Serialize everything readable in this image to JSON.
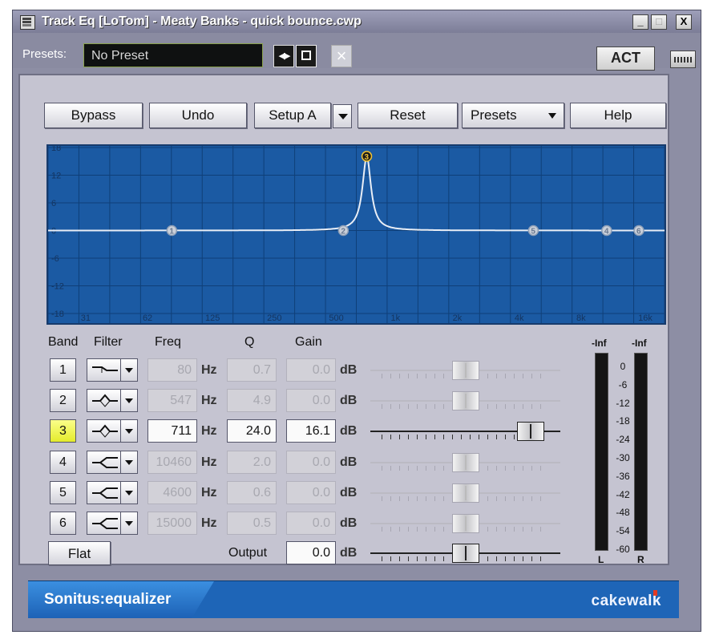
{
  "window": {
    "title": "Track Eq [LoTom] - Meaty Banks - quick bounce.cwp",
    "buttons": {
      "minimize": "_",
      "maximize": "□",
      "close": "X"
    }
  },
  "presets_bar": {
    "label": "Presets:",
    "value": "No Preset",
    "act_label": "ACT"
  },
  "toolbar": {
    "bypass": "Bypass",
    "undo": "Undo",
    "setup": "Setup A",
    "reset": "Reset",
    "presets": "Presets",
    "help": "Help"
  },
  "graph": {
    "y_ticks": [
      "18",
      "12",
      "6",
      "0",
      "-6",
      "-12",
      "-18"
    ],
    "x_ticks": [
      "31",
      "62",
      "125",
      "250",
      "500",
      "1k",
      "2k",
      "4k",
      "8k",
      "16k"
    ],
    "y_range": [
      -18,
      18
    ],
    "bands": [
      {
        "id": "1",
        "freq_hz": 80,
        "gain_db": 0
      },
      {
        "id": "2",
        "freq_hz": 547,
        "gain_db": 0
      },
      {
        "id": "3",
        "freq_hz": 711,
        "gain_db": 16.1
      },
      {
        "id": "4",
        "freq_hz": 10460,
        "gain_db": 0
      },
      {
        "id": "5",
        "freq_hz": 4600,
        "gain_db": 0
      },
      {
        "id": "6",
        "freq_hz": 15000,
        "gain_db": 0
      }
    ],
    "colors": {
      "background": "#1b5aa3",
      "grid": "#0f3f78",
      "curve": "#e9eef6"
    }
  },
  "columns": {
    "band": "Band",
    "filter": "Filter",
    "freq": "Freq",
    "q": "Q",
    "gain": "Gain"
  },
  "units": {
    "hz": "Hz",
    "db": "dB"
  },
  "bands": [
    {
      "num": "1",
      "filter": "low-shelf",
      "freq": "80",
      "q": "0.7",
      "gain": "0.0",
      "active": false,
      "level": 0.5
    },
    {
      "num": "2",
      "filter": "peak",
      "freq": "547",
      "q": "4.9",
      "gain": "0.0",
      "active": false,
      "level": 0.5
    },
    {
      "num": "3",
      "filter": "peak",
      "freq": "711",
      "q": "24.0",
      "gain": "16.1",
      "active": true,
      "level": 0.9
    },
    {
      "num": "4",
      "filter": "high-shelf",
      "freq": "10460",
      "q": "2.0",
      "gain": "0.0",
      "active": false,
      "level": 0.5
    },
    {
      "num": "5",
      "filter": "high-shelf",
      "freq": "4600",
      "q": "0.6",
      "gain": "0.0",
      "active": false,
      "level": 0.5
    },
    {
      "num": "6",
      "filter": "high-shelf",
      "freq": "15000",
      "q": "0.5",
      "gain": "0.0",
      "active": false,
      "level": 0.5
    }
  ],
  "flat_button": "Flat",
  "output": {
    "label": "Output",
    "value": "0.0",
    "level": 0.5
  },
  "meters": {
    "top_left": "-Inf",
    "top_right": "-Inf",
    "scale": [
      "0",
      "-6",
      "-12",
      "-18",
      "-24",
      "-30",
      "-36",
      "-42",
      "-48",
      "-54",
      "-60"
    ],
    "left_label": "L",
    "right_label": "R"
  },
  "footer": {
    "brand": "Sonitus:equalizer",
    "company": "cakewalk"
  }
}
